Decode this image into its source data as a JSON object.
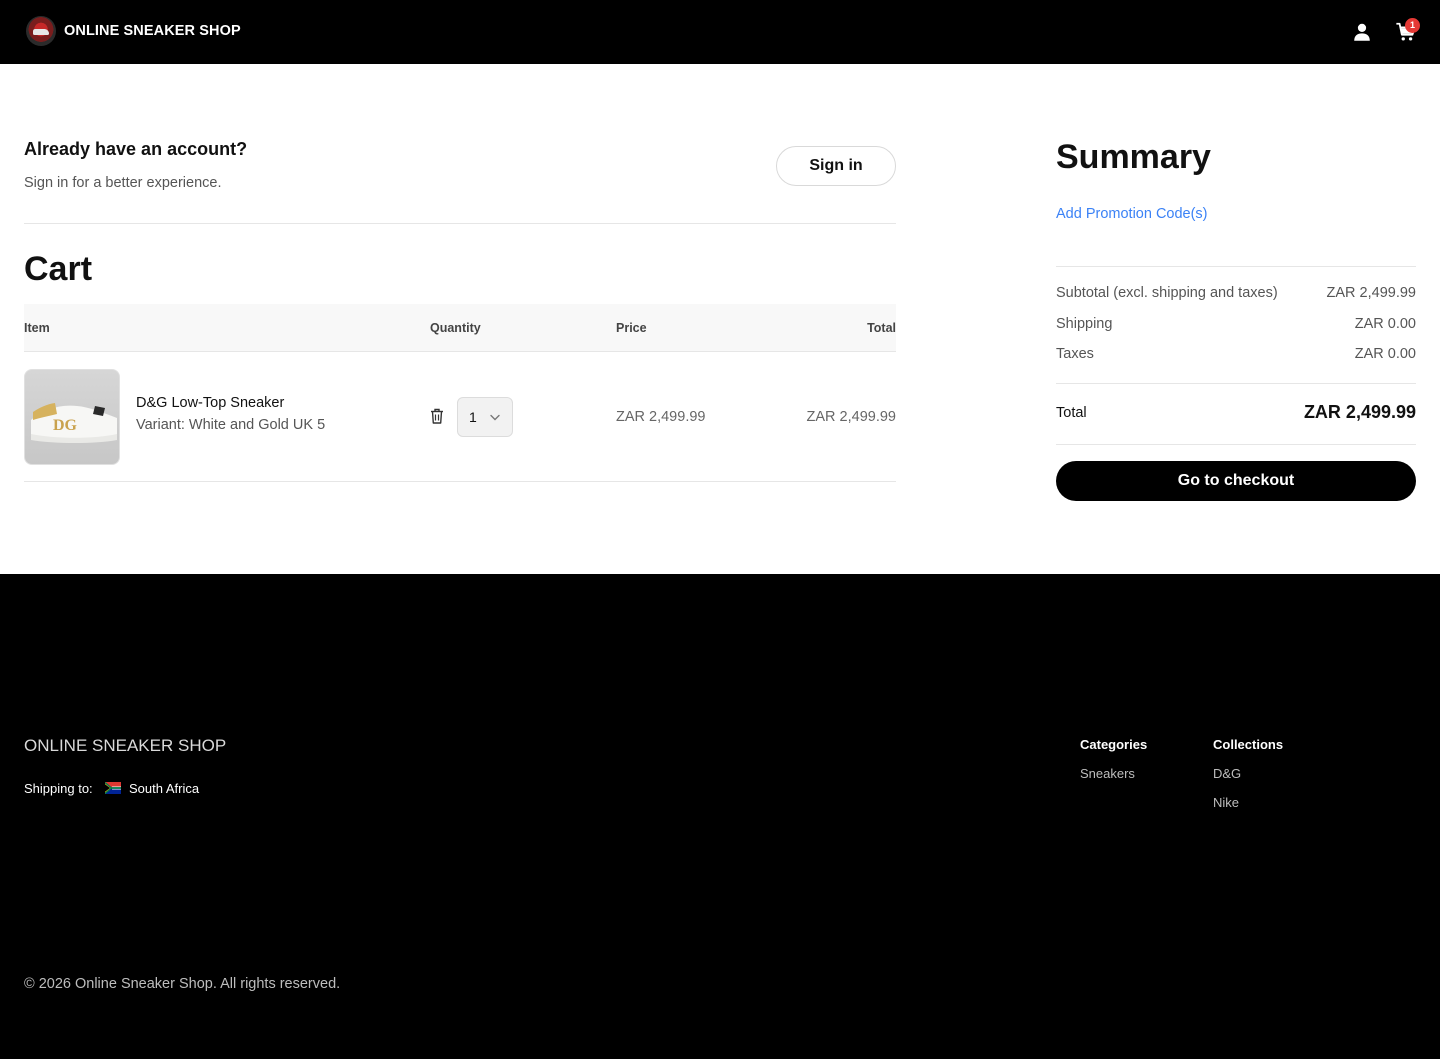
{
  "header": {
    "brand_name": "ONLINE SNEAKER SHOP",
    "cart_count": "1",
    "logo_icon": "sneaker-logo-icon",
    "user_icon": "user-icon",
    "cart_icon": "shopping-cart-icon"
  },
  "account": {
    "title": "Already have an account?",
    "subtitle": "Sign in for a better experience.",
    "signin_label": "Sign in"
  },
  "cart": {
    "title": "Cart",
    "columns": {
      "item": "Item",
      "quantity": "Quantity",
      "price": "Price",
      "total": "Total"
    },
    "items": [
      {
        "name": "D&G Low-Top Sneaker",
        "variant": "Variant: White and Gold UK 5",
        "quantity": "1",
        "price": "ZAR 2,499.99",
        "total": "ZAR 2,499.99"
      }
    ]
  },
  "summary": {
    "title": "Summary",
    "promo_label": "Add Promotion Code(s)",
    "subtotal_label": "Subtotal (excl. shipping and taxes)",
    "subtotal_value": "ZAR 2,499.99",
    "shipping_label": "Shipping",
    "shipping_value": "ZAR 0.00",
    "taxes_label": "Taxes",
    "taxes_value": "ZAR 0.00",
    "total_label": "Total",
    "total_value": "ZAR 2,499.99",
    "checkout_label": "Go to checkout"
  },
  "footer": {
    "brand_name": "ONLINE SNEAKER SHOP",
    "shipping_label": "Shipping to:",
    "country": "South Africa",
    "categories": {
      "title": "Categories",
      "links": [
        "Sneakers"
      ]
    },
    "collections": {
      "title": "Collections",
      "links": [
        "D&G",
        "Nike"
      ]
    },
    "copyright": "© 2026 Online Sneaker Shop. All rights reserved."
  },
  "colors": {
    "header_bg": "#000000",
    "accent_link": "#3b82f6",
    "badge": "#e53935",
    "checkout_bg": "#000000"
  }
}
